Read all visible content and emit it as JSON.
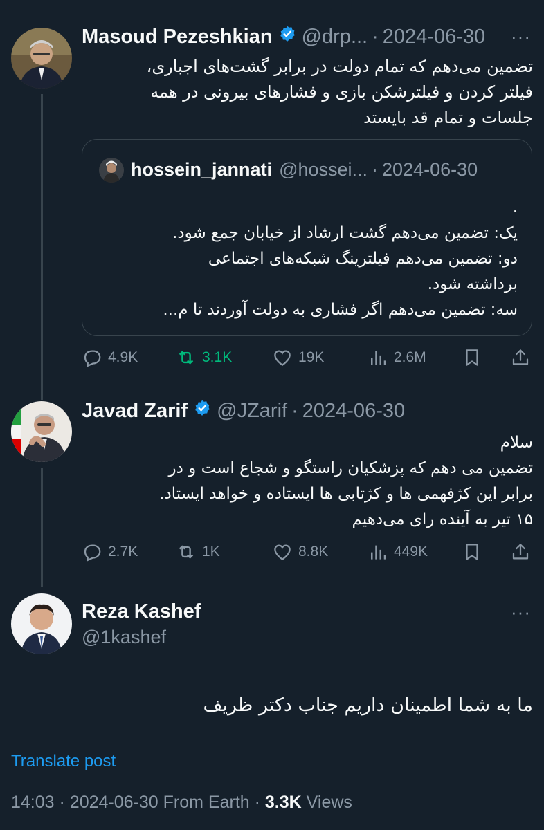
{
  "tweet1": {
    "author": "Masoud Pezeshkian",
    "handle": "@drp...",
    "sep": "·",
    "date": "2024-06-30",
    "more": "···",
    "text_lines": [
      "تضمین می‌دهم که تمام دولت در برابر  گشت‌های اجباری،",
      "فیلتر کردن و فیلترشکن بازی و فشارهای بیرونی در همه",
      "جلسات و تمام قد بایستد"
    ],
    "quote": {
      "author": "hossein_jannati",
      "handle": "@hossei...",
      "sep": "·",
      "date": "2024-06-30",
      "text_lines": [
        ".",
        "یک: تضمین می‌دهم گشت ارشاد از خیابان جمع شود.",
        "دو: تضمین می‌دهم فیلترینگ شبکه‌های اجتماعی",
        "برداشته شود.",
        "سه: تضمین می‌دهم اگر فشاری به دولت آوردند تا م..."
      ]
    },
    "stats": {
      "replies": "4.9K",
      "reposts": "3.1K",
      "likes": "19K",
      "views": "2.6M"
    }
  },
  "tweet2": {
    "author": "Javad Zarif",
    "handle": "@JZarif",
    "sep": "·",
    "date": "2024-06-30",
    "text_lines": [
      "سلام",
      "تضمین می دهم که پزشکیان راستگو و شجاع است و  در",
      "برابر این کژفهمی ها و کژتابی ها ایستاده و خواهد ایستاد.",
      "۱۵ تیر به آینده رای می‌دهیم"
    ],
    "stats": {
      "replies": "2.7K",
      "reposts": "1K",
      "likes": "8.8K",
      "views": "449K"
    }
  },
  "tweet3": {
    "author": "Reza Kashef",
    "handle": "@1kashef",
    "text": "ما به شما اطمینان داریم جناب دکتر ظریف",
    "translate": "Translate post",
    "footer_time": "14:03",
    "footer_sep1": "·",
    "footer_date": "2024-06-30",
    "footer_from": "From Earth",
    "footer_sep2": "·",
    "footer_views": "3.3K",
    "footer_views_label": "Views"
  },
  "colors": {
    "background": "#15202b",
    "text": "#f7f9f9",
    "muted": "#8b98a5",
    "accent": "#1d9bf0",
    "repost_active": "#00ba7c",
    "border": "#38444d"
  },
  "icons": [
    "verified-badge-icon",
    "reply-icon",
    "repost-icon",
    "like-icon",
    "views-icon",
    "bookmark-icon",
    "share-icon",
    "more-icon"
  ]
}
